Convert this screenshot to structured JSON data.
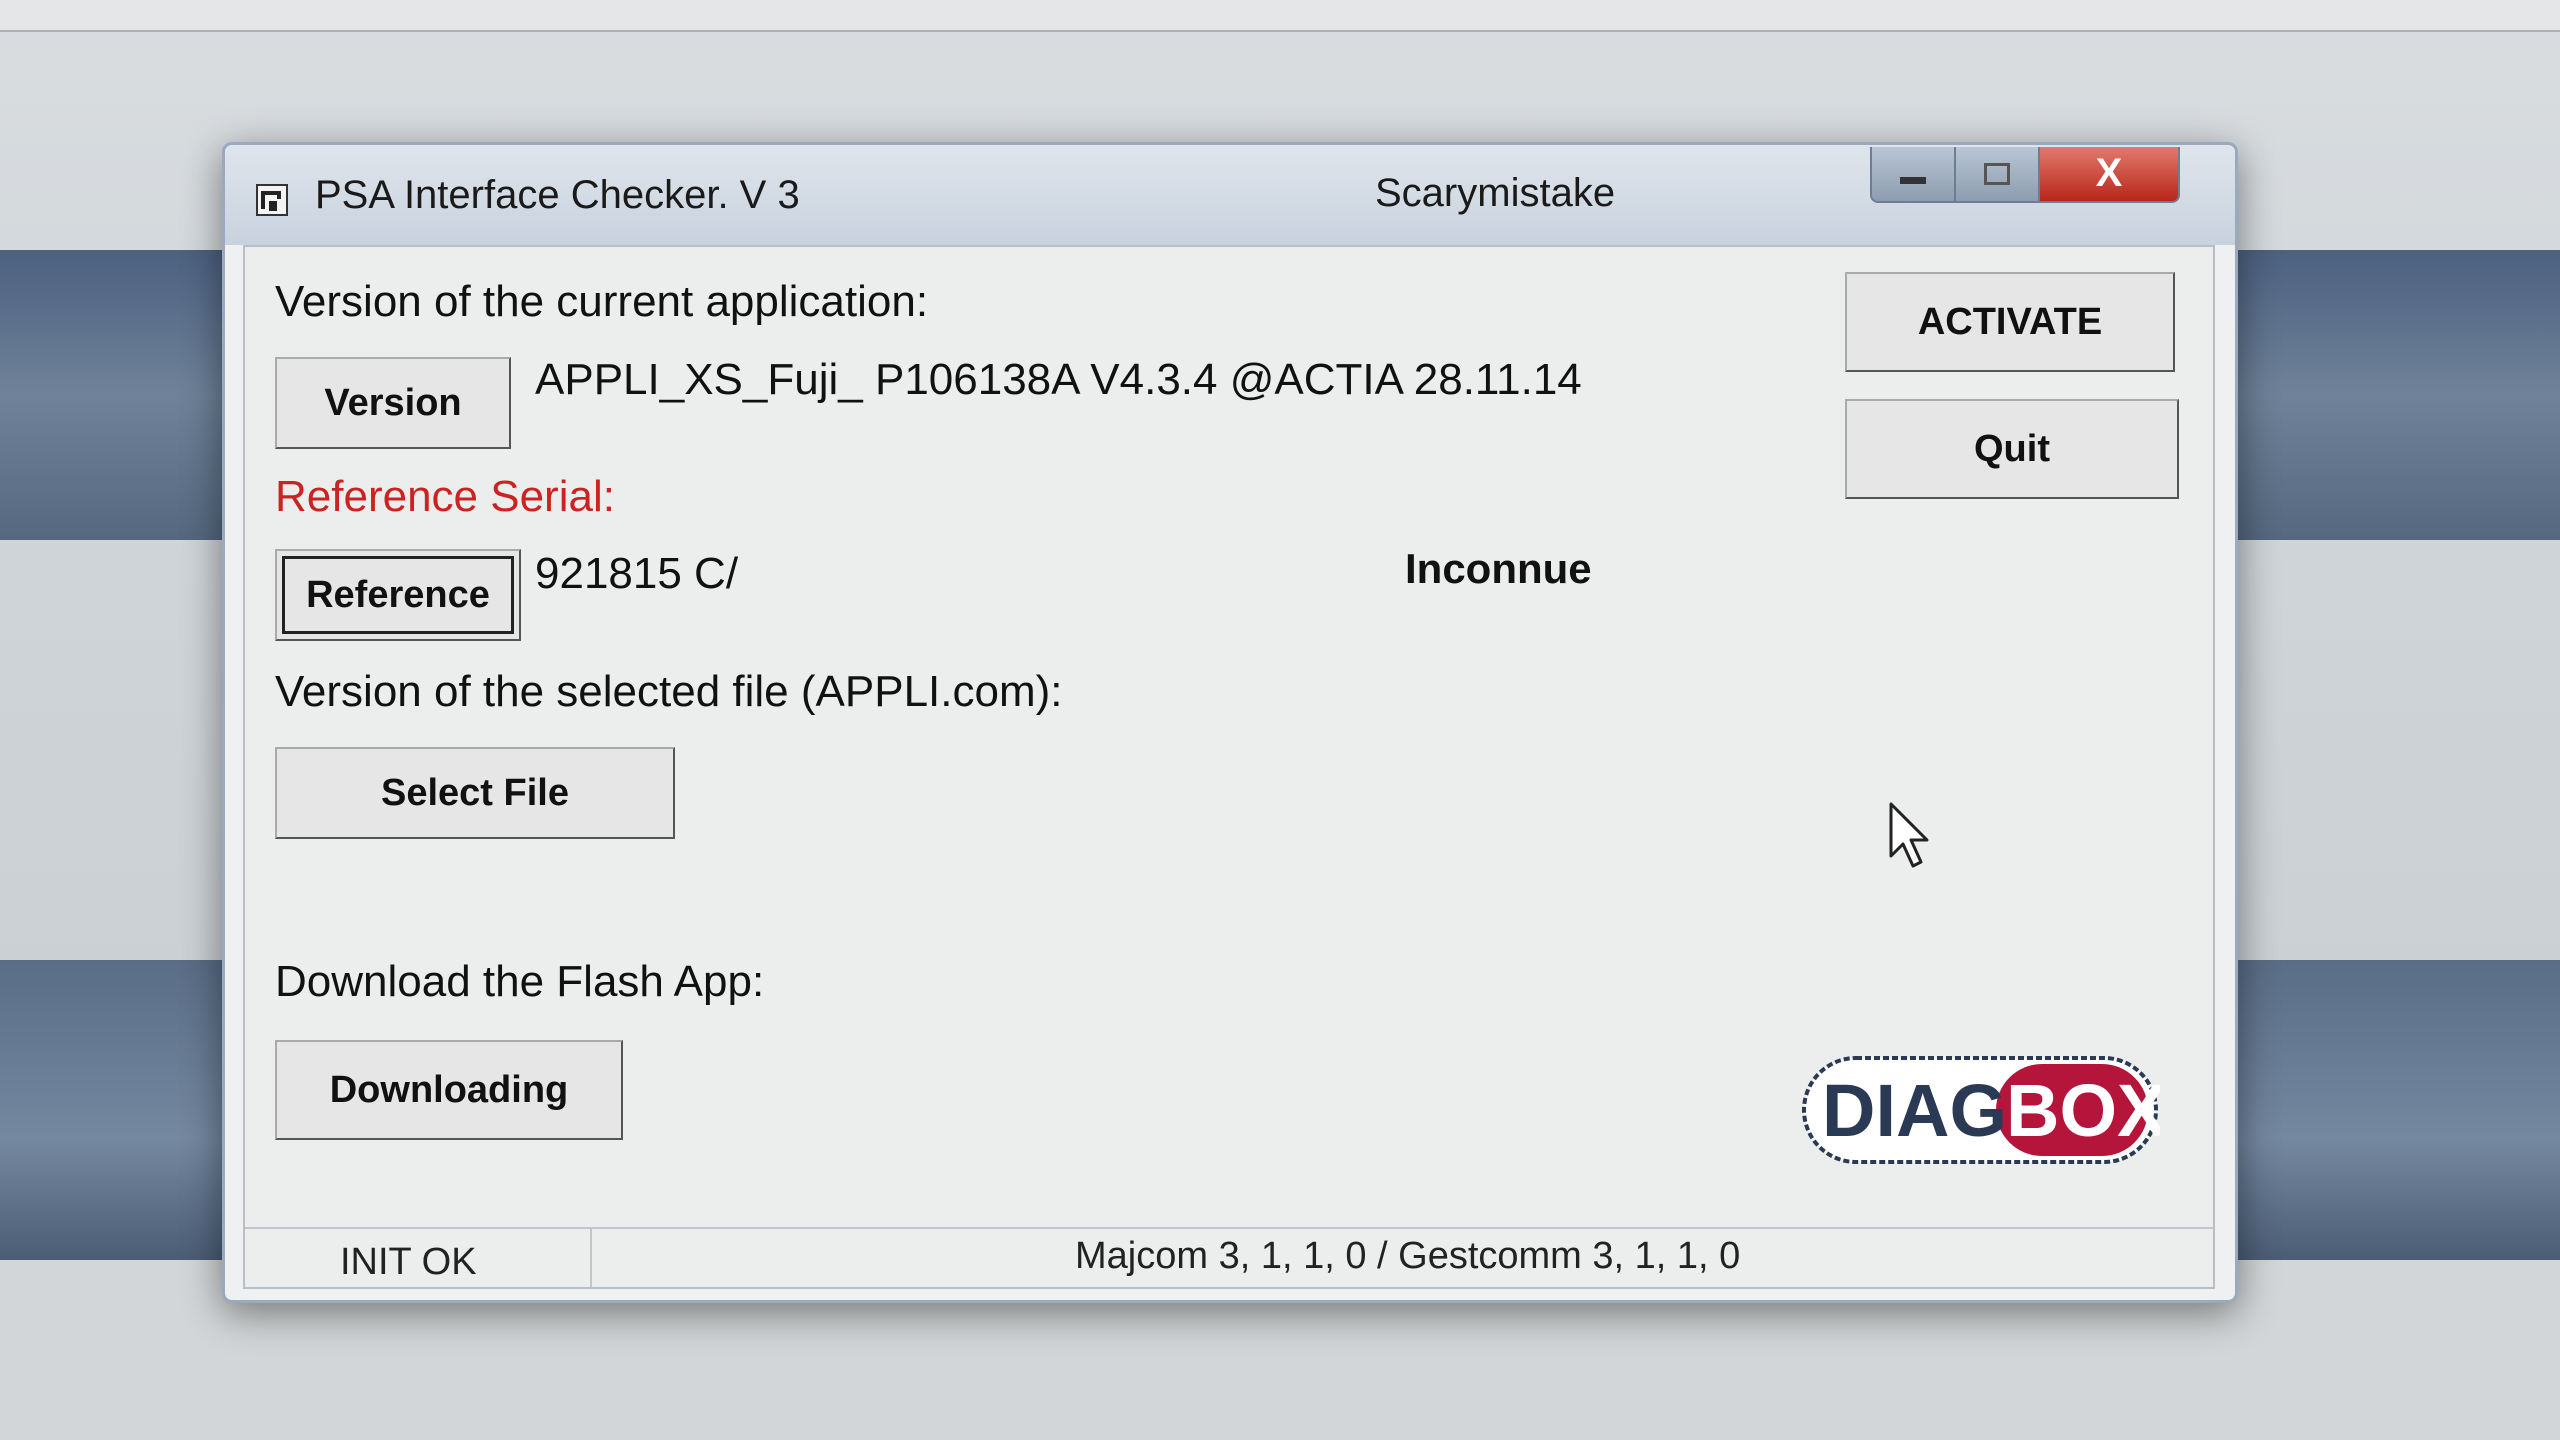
{
  "window": {
    "title": "PSA Interface Checker. V 3",
    "user": "Scarymistake",
    "close_label": "X"
  },
  "section_version": {
    "label": "Version of the current application:",
    "button": "Version",
    "value": "APPLI_XS_Fuji_ P106138A  V4.3.4 @ACTIA 28.11.14"
  },
  "section_reference": {
    "label": "Reference Serial:",
    "button": "Reference",
    "value": "921815  C/",
    "status": "Inconnue"
  },
  "section_file": {
    "label": "Version of the selected file (APPLI.com):",
    "button": "Select File"
  },
  "section_download": {
    "label": "Download the Flash App:",
    "button": "Downloading"
  },
  "side_buttons": {
    "activate": "ACTIVATE",
    "quit": "Quit"
  },
  "logo": {
    "text_left": "DIAG",
    "text_right": "BOX"
  },
  "statusbar": {
    "left": "INIT OK",
    "right": "Majcom 3, 1, 1, 0 / Gestcomm 3, 1, 1, 0"
  },
  "colors": {
    "reference_label": "#cc2222",
    "logo_dark": "#2a3a55",
    "logo_red": "#b5153a"
  }
}
